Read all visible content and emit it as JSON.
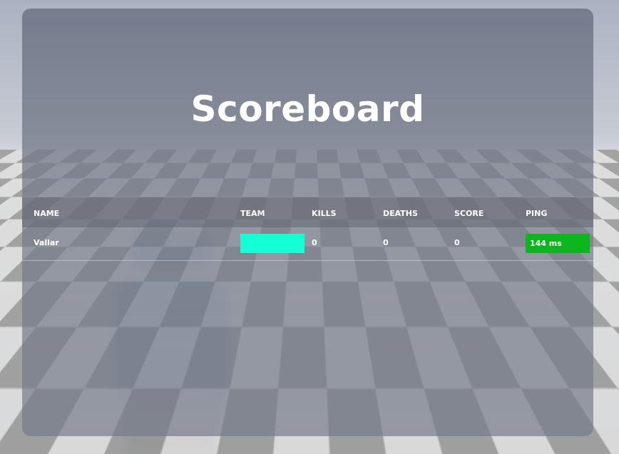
{
  "scoreboard": {
    "title": "Scoreboard",
    "columns": {
      "name": "NAME",
      "team": "TEAM",
      "kills": "KILLS",
      "deaths": "DEATHS",
      "score": "SCORE",
      "ping": "PING"
    },
    "rows": [
      {
        "name": "Vallar",
        "team_color": "#14ffd6",
        "kills": "0",
        "deaths": "0",
        "score": "0",
        "ping": "144 ms",
        "ping_color": "#0db51f"
      }
    ]
  }
}
